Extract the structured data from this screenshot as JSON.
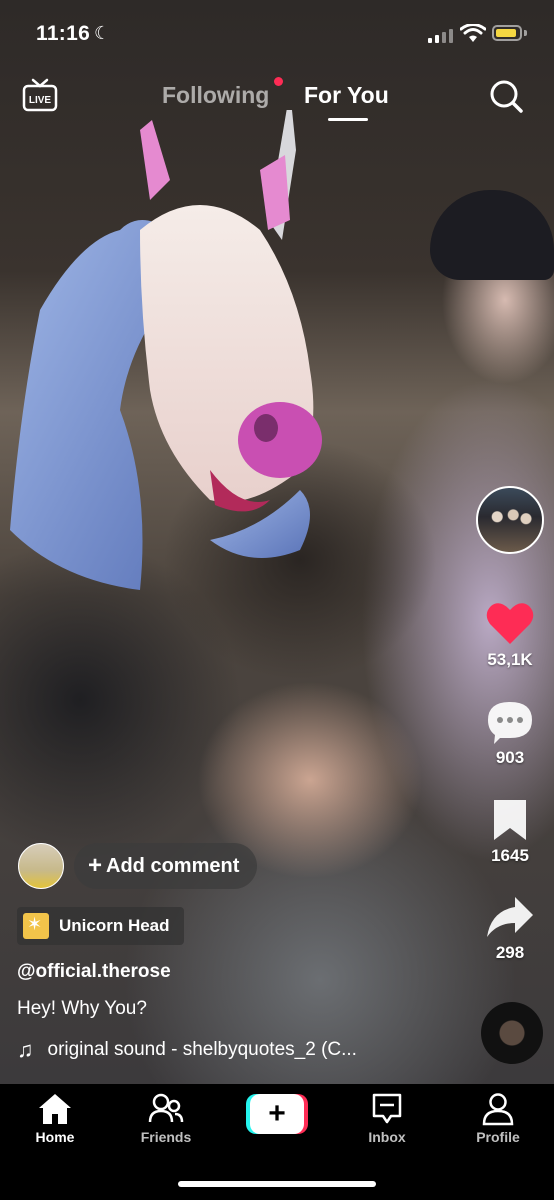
{
  "status_bar": {
    "time": "11:16",
    "moon_icon": "moon-icon",
    "battery_color": "#f5d742"
  },
  "top_nav": {
    "live_label": "LIVE",
    "tabs": [
      {
        "label": "Following",
        "active": false
      },
      {
        "label": "For You",
        "active": true
      }
    ],
    "accent_dot_color": "#fe2c55"
  },
  "rail": {
    "likes": "53,1K",
    "comments": "903",
    "bookmarks": "1645",
    "shares": "298",
    "like_color": "#fe2c55"
  },
  "post": {
    "add_comment_label": "Add comment",
    "effect_label": "Unicorn Head",
    "username": "@official.therose",
    "caption": "Hey! Why You?",
    "sound": "original sound - shelbyquotes_2 (C..."
  },
  "bottom_nav": {
    "home": "Home",
    "friends": "Friends",
    "create": "+",
    "inbox": "Inbox",
    "profile": "Profile"
  }
}
